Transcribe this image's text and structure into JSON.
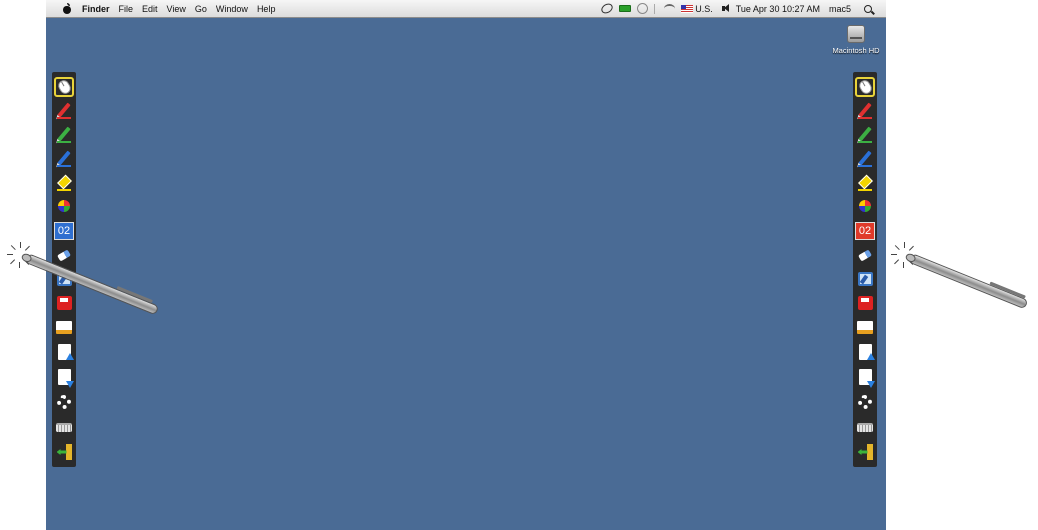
{
  "menubar": {
    "app_name": "Finder",
    "menus": [
      "File",
      "Edit",
      "View",
      "Go",
      "Window",
      "Help"
    ],
    "input_source": "U.S.",
    "clock": "Tue Apr 30  10:27 AM",
    "user": "mac5"
  },
  "desktop": {
    "background_color": "#4a6b95",
    "icon_label": "Macintosh HD"
  },
  "toolbar_left": {
    "page_number": "02",
    "page_color": "#2f6fd0"
  },
  "toolbar_right": {
    "page_number": "02",
    "page_color": "#e03a2a"
  },
  "tools": [
    "mouse-icon",
    "red-pen-icon",
    "green-pen-icon",
    "blue-pen-icon",
    "highlighter-icon",
    "color-palette-icon",
    "page-number-icon",
    "eraser-icon",
    "screen-capture-icon",
    "save-icon",
    "whiteboard-icon",
    "previous-page-icon",
    "next-page-icon",
    "gear-icon",
    "keyboard-icon",
    "exit-icon"
  ]
}
